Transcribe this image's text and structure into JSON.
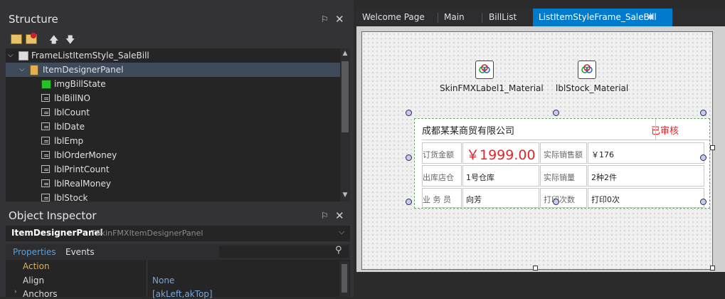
{
  "structure": {
    "title": "Structure",
    "pin_glyph": "⚐",
    "close_glyph": "✕",
    "toolbar": [
      "open-folder-icon",
      "delete-icon",
      "move-up-icon",
      "move-down-icon"
    ],
    "tree": [
      {
        "label": "FrameListItemStyle_SaleBill",
        "level": 0,
        "icon": "frame-icon",
        "expanded": true
      },
      {
        "label": "ItemDesignerPanel",
        "level": 1,
        "icon": "panel-icon",
        "expanded": true,
        "selected": true
      },
      {
        "label": "imgBillState",
        "level": 2,
        "icon": "image-icon"
      },
      {
        "label": "lblBillNO",
        "level": 2,
        "icon": "label-icon"
      },
      {
        "label": "lblCount",
        "level": 2,
        "icon": "label-icon"
      },
      {
        "label": "lblDate",
        "level": 2,
        "icon": "label-icon"
      },
      {
        "label": "lblEmp",
        "level": 2,
        "icon": "label-icon"
      },
      {
        "label": "lblOrderMoney",
        "level": 2,
        "icon": "label-icon"
      },
      {
        "label": "lblPrintCount",
        "level": 2,
        "icon": "label-icon"
      },
      {
        "label": "lblRealMoney",
        "level": 2,
        "icon": "label-icon"
      },
      {
        "label": "lblStock",
        "level": 2,
        "icon": "label-icon"
      }
    ]
  },
  "inspector": {
    "title": "Object Inspector",
    "object_name": "ItemDesignerPanel",
    "object_type": "TSkinFMXItemDesignerPanel",
    "tabs": [
      "Properties",
      "Events"
    ],
    "properties": [
      {
        "name": "Action",
        "value": "",
        "highlight": true
      },
      {
        "name": "Align",
        "value": "None"
      },
      {
        "name": "Anchors",
        "value": "[akLeft,akTop]"
      }
    ]
  },
  "tabs": [
    {
      "label": "Welcome Page"
    },
    {
      "label": "Main"
    },
    {
      "label": "BillList"
    },
    {
      "label": "ListItemStyleFrame_SaleBill",
      "active": true,
      "modified_dot": "●"
    }
  ],
  "designer": {
    "components": [
      {
        "label": "SkinFMXLabel1_Material"
      },
      {
        "label": "lblStock_Material"
      }
    ],
    "bill": {
      "company": "成都某某商贸有限公司",
      "status": "已审核",
      "rows": [
        {
          "cap1": "订货金额",
          "val1": "￥1999.00",
          "cap2": "实际销售额",
          "val2": "￥176"
        },
        {
          "cap1": "出库店仓",
          "val1": "1号仓库",
          "cap2": "实际销量",
          "val2": "2种2件"
        },
        {
          "cap1": "业 务 员",
          "val1": "向芳",
          "cap2": "打印次数",
          "val2": "打印0次"
        }
      ]
    }
  },
  "colors": {
    "accent": "#007acc",
    "status_red": "#e0262b",
    "selection": "#3f4a5a",
    "property_highlight": "#e0b050"
  }
}
